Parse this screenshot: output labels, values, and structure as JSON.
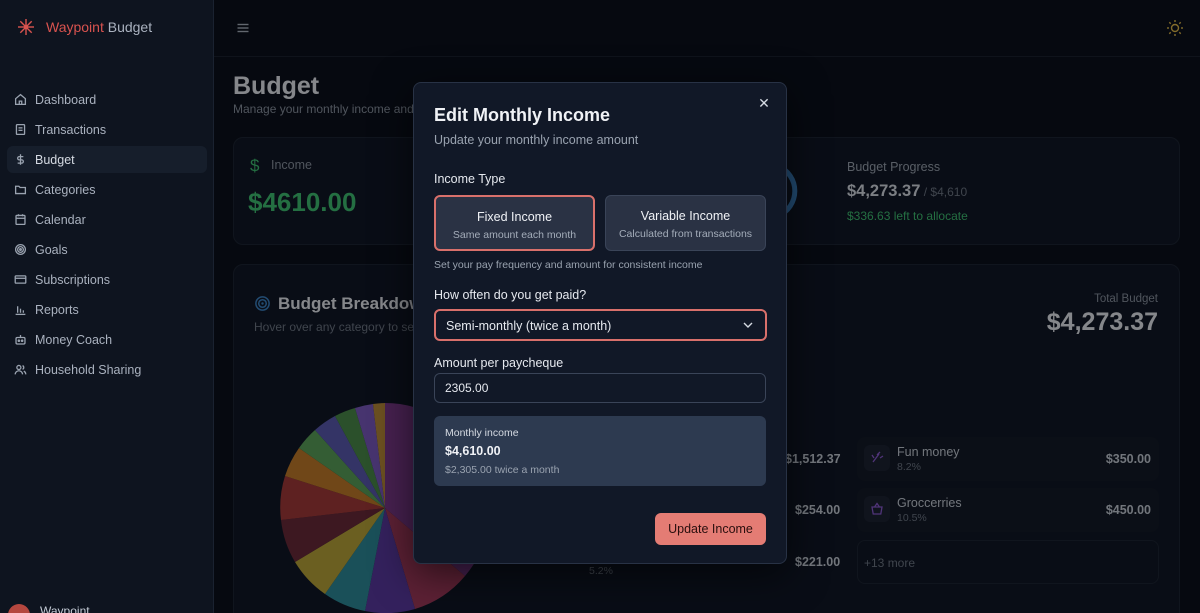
{
  "app": {
    "brand_part1": "Waypoint",
    "brand_part2": " Budget"
  },
  "sidebar": {
    "items": [
      {
        "label": "Dashboard",
        "icon": "home-icon"
      },
      {
        "label": "Transactions",
        "icon": "receipt-icon"
      },
      {
        "label": "Budget",
        "icon": "dollar-icon",
        "active": true
      },
      {
        "label": "Categories",
        "icon": "folder-icon"
      },
      {
        "label": "Calendar",
        "icon": "calendar-icon"
      },
      {
        "label": "Goals",
        "icon": "target-icon"
      },
      {
        "label": "Subscriptions",
        "icon": "card-icon"
      },
      {
        "label": "Reports",
        "icon": "bar-chart-icon"
      },
      {
        "label": "Money Coach",
        "icon": "bot-icon"
      },
      {
        "label": "Household Sharing",
        "icon": "users-icon"
      }
    ],
    "user_name": "Waypoint"
  },
  "page": {
    "title": "Budget",
    "subtitle": "Manage your monthly income and"
  },
  "income_card": {
    "label": "Income",
    "value": "$4610.00"
  },
  "progress_card": {
    "label": "Budget Progress",
    "amount": "$4,273.37",
    "of": " / $4,610",
    "left": "$336.63 left to allocate"
  },
  "breakdown": {
    "title": "Budget Breakdow",
    "hint": "Hover over any category to se",
    "total_label": "Total Budget",
    "total_value": "$4,273.37",
    "amounts": [
      "$1,512.37",
      "$254.00",
      "$221.00"
    ],
    "pct_stub": "5.2%",
    "categories": [
      {
        "name": "Fun money",
        "pct": "8.2%",
        "amount": "$350.00"
      },
      {
        "name": "Groccerries",
        "pct": "10.5%",
        "amount": "$450.00"
      }
    ],
    "more": "+13 more"
  },
  "modal": {
    "title": "Edit Monthly Income",
    "subtitle": "Update your monthly income amount",
    "income_type_label": "Income Type",
    "fixed_title": "Fixed Income",
    "fixed_sub": "Same amount each month",
    "variable_title": "Variable Income",
    "variable_sub": "Calculated from transactions",
    "help": "Set your pay frequency and amount for consistent income",
    "frequency_label": "How often do you get paid?",
    "frequency_value": "Semi-monthly (twice a month)",
    "amount_label": "Amount per paycheque",
    "amount_value": "2305.00",
    "summary_label": "Monthly income",
    "summary_value": "$4,610.00",
    "summary_detail": "$2,305.00 twice a month",
    "submit_label": "Update Income"
  },
  "colors": {
    "accent": "#e47c74",
    "positive": "#3fbf72",
    "background": "#0b111c"
  }
}
